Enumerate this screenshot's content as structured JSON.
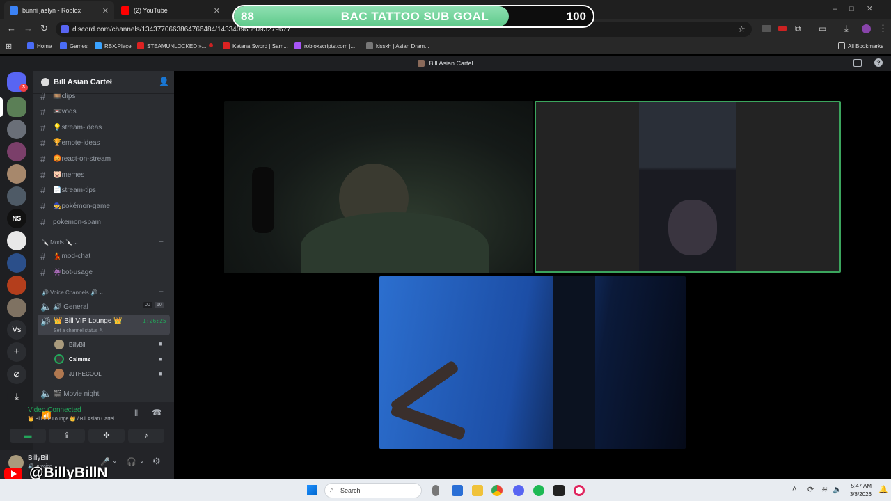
{
  "browser": {
    "tabs": [
      {
        "title": "bunni jaelyn - Roblox",
        "color": "#3b82f6"
      },
      {
        "title": "(2) YouTube",
        "color": "#ff0000"
      }
    ],
    "url": "discord.com/channels/1343770663864766484/1433409686093279677",
    "bookmarks": [
      {
        "label": "Home",
        "color": "#4a6cf7"
      },
      {
        "label": "Games",
        "color": "#4a6cf7"
      },
      {
        "label": "RBX.Place",
        "color": "#3aa3ff"
      },
      {
        "label": "STEAMUNLOCKED »...",
        "color": "#d22"
      },
      {
        "label": "Katana Sword | Sam...",
        "color": "#d22"
      },
      {
        "label": "robloxscripts.com |...",
        "color": "#a855f7"
      },
      {
        "label": "kisskh | Asian Dram...",
        "color": "#aaa"
      }
    ],
    "all_bookmarks": "All Bookmarks"
  },
  "sub_goal": {
    "current": "88",
    "title": "BAC TATTOO SUB GOAL",
    "target": "100",
    "progress": 0.88
  },
  "discord": {
    "window_title": "Bill Asian Cartel",
    "notification_count": "3",
    "server_name": "Bill Asian Cartel",
    "channels": [
      {
        "label": "clips",
        "emoji": "🎞️"
      },
      {
        "label": "vods",
        "emoji": "📼"
      },
      {
        "label": "stream-ideas",
        "emoji": "💡"
      },
      {
        "label": "emote-ideas",
        "emoji": "🏆"
      },
      {
        "label": "react-on-stream",
        "emoji": "😡"
      },
      {
        "label": "memes",
        "emoji": "🐷"
      },
      {
        "label": "stream-tips",
        "emoji": "📄"
      },
      {
        "label": "pokémon-game",
        "emoji": "🧙"
      },
      {
        "label": "pokemon-spam",
        "emoji": ""
      }
    ],
    "mods_category": "🔪 Mods 🔪",
    "mod_channels": [
      {
        "label": "mod-chat",
        "emoji": "💃"
      },
      {
        "label": "bot-usage",
        "emoji": "👾"
      }
    ],
    "voice_category": "🔊 Voice Channels 🔊",
    "general": {
      "label": "🔊 General",
      "count_a": "00",
      "count_b": "10"
    },
    "vip_lounge": {
      "label": "👑 Bill VIP Lounge 👑",
      "timer": "1:26:25",
      "status": "Set a channel status ✎"
    },
    "members": [
      {
        "name": "BillyBill",
        "color": "#a99a7c"
      },
      {
        "name": "Calmmz",
        "color": "#3a3a3a"
      },
      {
        "name": "JJTHECOOL",
        "color": "#b07850"
      }
    ],
    "movie_night": "🎬 Movie night",
    "voice_panel": {
      "status": "Video Connected",
      "location": "👑 Bill VIP Lounge 👑 / Bill Asian Cartel"
    },
    "user": {
      "name": "BillyBill",
      "status": "🔊 In voice"
    }
  },
  "overlay": {
    "youtube_handle": "@BillyBillN"
  },
  "taskbar": {
    "search": "Search",
    "time": "5:47 AM",
    "date": "3/8/2026"
  }
}
